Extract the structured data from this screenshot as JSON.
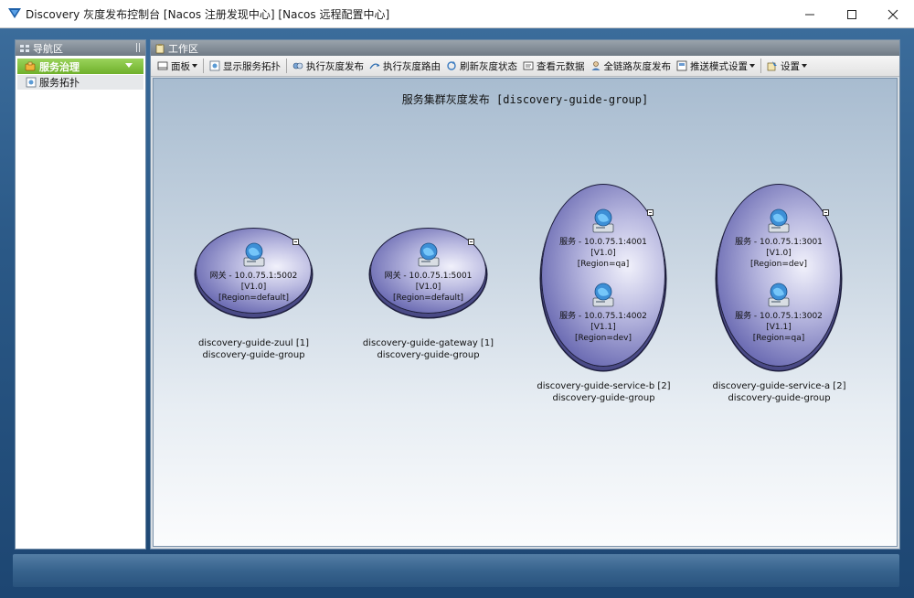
{
  "window": {
    "title": "Discovery 灰度发布控制台 [Nacos 注册发现中心] [Nacos 远程配置中心]"
  },
  "nav": {
    "header": "导航区",
    "section": "服务治理",
    "items": [
      {
        "label": "服务拓扑"
      }
    ]
  },
  "work": {
    "header": "工作区",
    "toolbar": [
      {
        "label": "面板",
        "icon": "panel-icon",
        "dropdown": true
      },
      {
        "label": "显示服务拓扑",
        "icon": "topology-icon",
        "dropdown": false
      },
      {
        "label": "执行灰度发布",
        "icon": "release-icon",
        "dropdown": false
      },
      {
        "label": "执行灰度路由",
        "icon": "route-icon",
        "dropdown": false
      },
      {
        "label": "刷新灰度状态",
        "icon": "refresh-icon",
        "dropdown": false
      },
      {
        "label": "查看元数据",
        "icon": "metadata-icon",
        "dropdown": false
      },
      {
        "label": "全链路灰度发布",
        "icon": "full-link-icon",
        "dropdown": false
      },
      {
        "label": "推送模式设置",
        "icon": "push-icon",
        "dropdown": true
      },
      {
        "label": "设置",
        "icon": "settings-icon",
        "dropdown": true
      }
    ],
    "canvas_title": "服务集群灰度发布 [discovery-guide-group]",
    "clusters": [
      {
        "name": "discovery-guide-zuul [1]",
        "group": "discovery-guide-group",
        "services": [
          {
            "addr": "网关 - 10.0.75.1:5002",
            "version": "[V1.0]",
            "region": "[Region=default]"
          }
        ]
      },
      {
        "name": "discovery-guide-gateway [1]",
        "group": "discovery-guide-group",
        "services": [
          {
            "addr": "网关 - 10.0.75.1:5001",
            "version": "[V1.0]",
            "region": "[Region=default]"
          }
        ]
      },
      {
        "name": "discovery-guide-service-b [2]",
        "group": "discovery-guide-group",
        "services": [
          {
            "addr": "服务 - 10.0.75.1:4001",
            "version": "[V1.0]",
            "region": "[Region=qa]"
          },
          {
            "addr": "服务 - 10.0.75.1:4002",
            "version": "[V1.1]",
            "region": "[Region=dev]"
          }
        ]
      },
      {
        "name": "discovery-guide-service-a [2]",
        "group": "discovery-guide-group",
        "services": [
          {
            "addr": "服务 - 10.0.75.1:3001",
            "version": "[V1.0]",
            "region": "[Region=dev]"
          },
          {
            "addr": "服务 - 10.0.75.1:3002",
            "version": "[V1.1]",
            "region": "[Region=qa]"
          }
        ]
      }
    ]
  },
  "colors": {
    "accent_green": "#7bbf35",
    "title_blue": "#1d5fa8",
    "node_purple": "#6f6fb5"
  }
}
